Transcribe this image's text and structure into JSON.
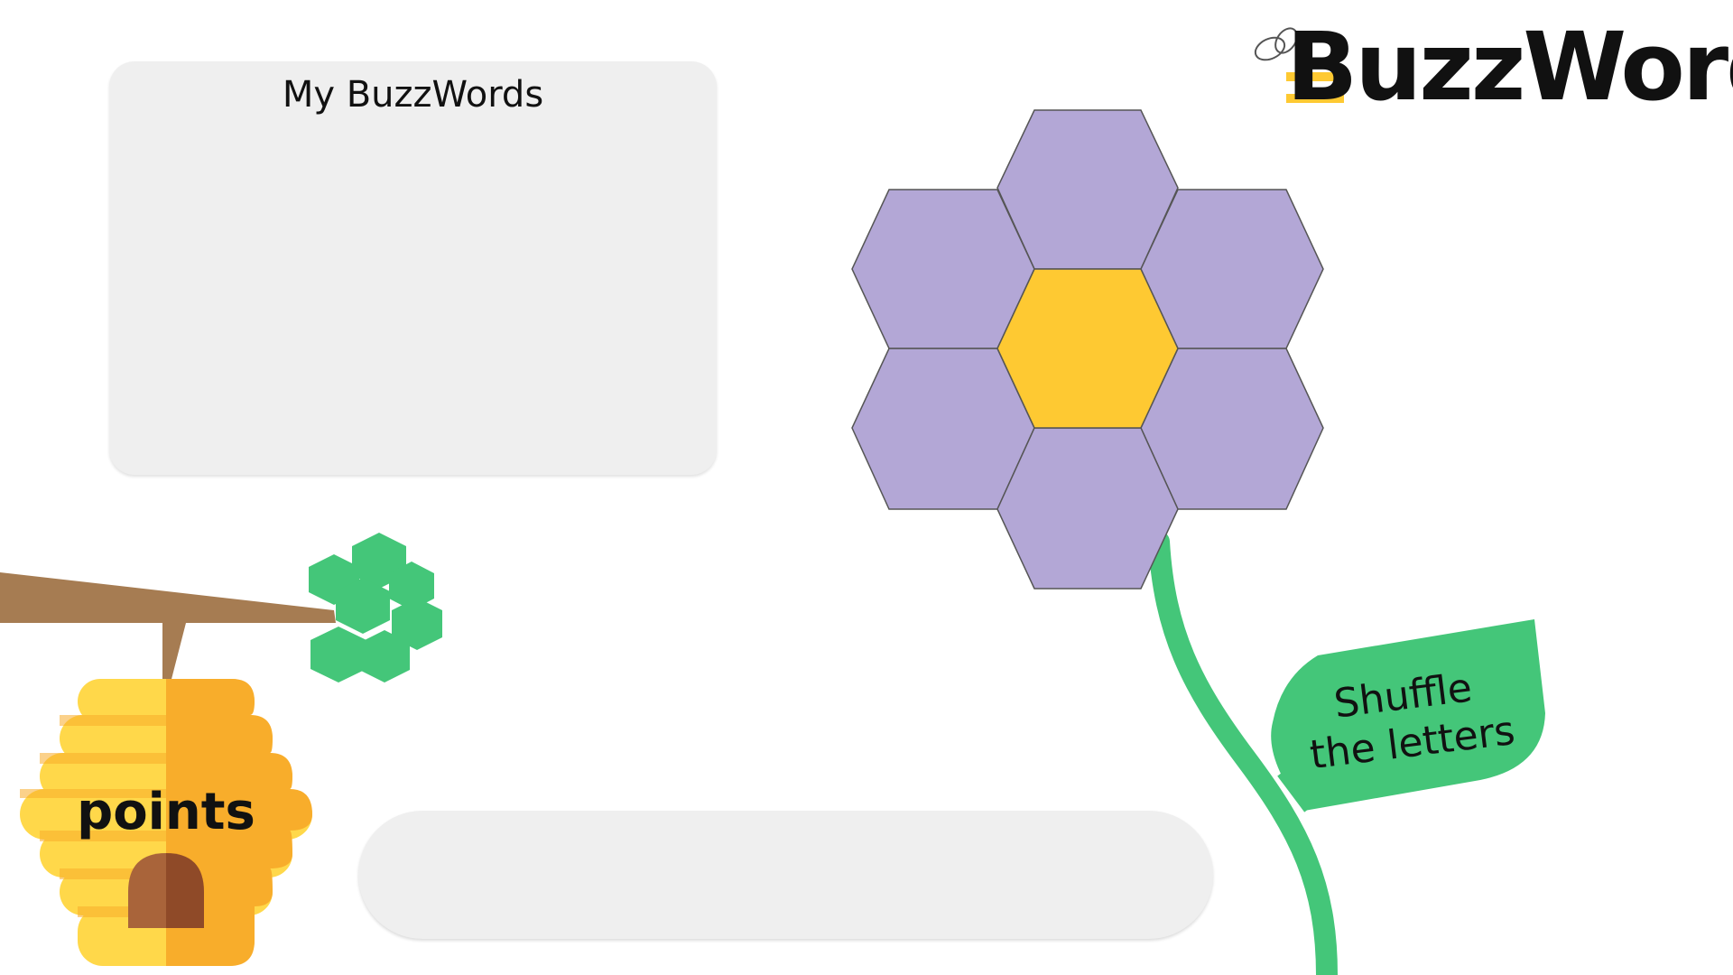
{
  "app": {
    "logo_text": "BuzzWords"
  },
  "words_panel": {
    "title": "My BuzzWords",
    "words": []
  },
  "hive": {
    "label": "points"
  },
  "leaf_button": {
    "line1": "Shuffle",
    "line2": "the letters"
  },
  "entry": {
    "current_word": ""
  },
  "flower": {
    "center_letter": "",
    "outer_letters": [
      "",
      "",
      "",
      "",
      "",
      ""
    ]
  },
  "colors": {
    "petal": "#b3a7d6",
    "center": "#fec932",
    "stem_green": "#44c679",
    "branch": "#a67c52",
    "hive_light": "#ffd84a",
    "hive_dark": "#f8ad2b",
    "door_light": "#a9643a",
    "door_dark": "#8f4a28",
    "panel_gray": "#efefef"
  }
}
